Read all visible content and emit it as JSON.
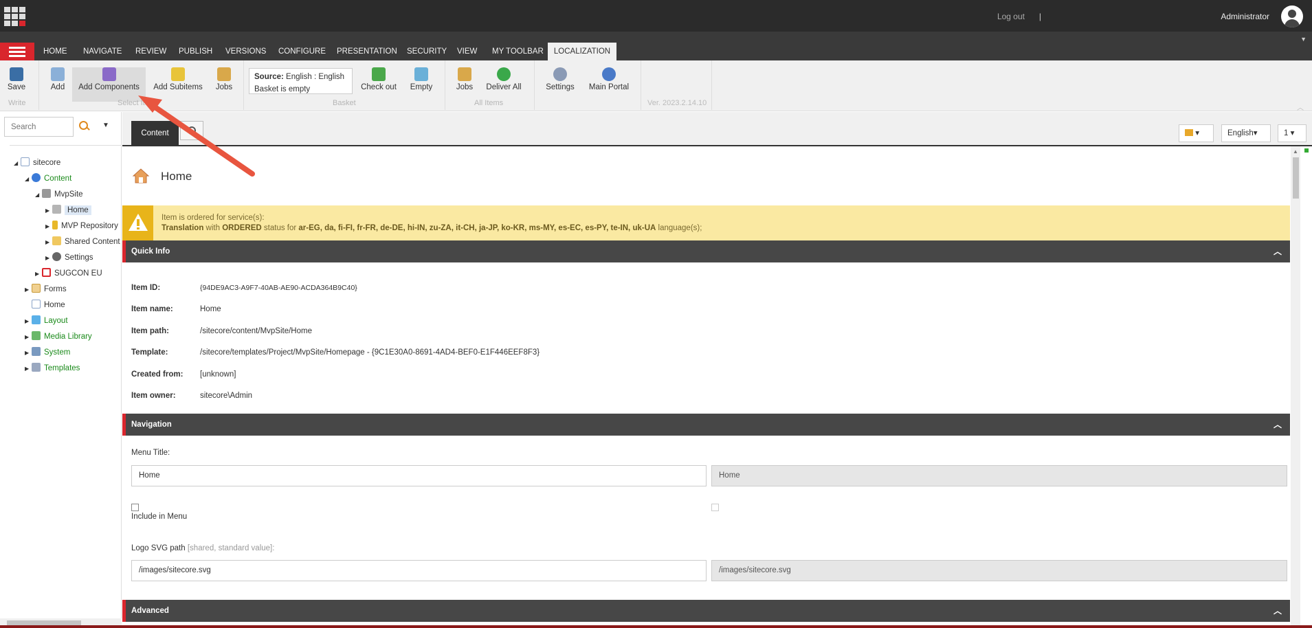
{
  "header": {
    "logout_label": "Log out",
    "separator": "|",
    "user_name": "Administrator"
  },
  "ribbon_tabs": [
    "HOME",
    "NAVIGATE",
    "REVIEW",
    "PUBLISH",
    "VERSIONS",
    "CONFIGURE",
    "PRESENTATION",
    "SECURITY",
    "VIEW",
    "MY TOOLBAR",
    "LOCALIZATION"
  ],
  "active_tab": "LOCALIZATION",
  "ribbon": {
    "save": "Save",
    "write_group": "Write",
    "add": "Add",
    "add_components": "Add Components",
    "add_subitems": "Add Subitems",
    "jobs": "Jobs",
    "select_item_group": "Select Item",
    "basket_source_label": "Source:",
    "basket_source_value": "English : English",
    "basket_status": "Basket is empty",
    "check_out": "Check out",
    "empty": "Empty",
    "basket_group": "Basket",
    "jobs2": "Jobs",
    "deliver_all": "Deliver All",
    "all_items_group": "All Items",
    "settings": "Settings",
    "main_portal": "Main Portal",
    "version": "Ver. 2023.2.14.10"
  },
  "search": {
    "placeholder": "Search"
  },
  "tree": {
    "sitecore": "sitecore",
    "content": "Content",
    "mvpsite": "MvpSite",
    "home": "Home",
    "mvp_repository": "MVP Repository",
    "shared_content": "Shared Content",
    "settings": "Settings",
    "sugcon": "SUGCON EU",
    "forms": "Forms",
    "home_root": "Home",
    "layout": "Layout",
    "media_library": "Media Library",
    "system": "System",
    "templates": "Templates"
  },
  "content_tabs": {
    "content": "Content",
    "language": "English",
    "version": "1"
  },
  "item": {
    "title": "Home",
    "warning_line1": "Item is ordered for service(s):",
    "warning_bold1": "Translation",
    "warning_mid1": " with ",
    "warning_bold2": "ORDERED",
    "warning_mid2": " status for ",
    "warning_langs": "ar-EG, da, fi-FI, fr-FR, de-DE, hi-IN, zu-ZA, it-CH, ja-JP, ko-KR, ms-MY, es-EC, es-PY, te-IN, uk-UA",
    "warning_end": " language(s);"
  },
  "quick_info": {
    "title": "Quick Info",
    "id_label": "Item ID:",
    "id_value": "{94DE9AC3-A9F7-40AB-AE90-ACDA364B9C40}",
    "name_label": "Item name:",
    "name_value": "Home",
    "path_label": "Item path:",
    "path_value": "/sitecore/content/MvpSite/Home",
    "template_label": "Template:",
    "template_value": "/sitecore/templates/Project/MvpSite/Homepage - {9C1E30A0-8691-4AD4-BEF0-E1F446EEF8F3}",
    "created_label": "Created from:",
    "created_value": "[unknown]",
    "owner_label": "Item owner:",
    "owner_value": "sitecore\\Admin"
  },
  "navigation": {
    "title": "Navigation",
    "menu_title_label": "Menu Title:",
    "menu_title_value": "Home",
    "menu_title_standard": "Home",
    "include_in_menu": "Include in Menu",
    "logo_label": "Logo SVG path",
    "logo_hint": " [shared, standard value]:",
    "logo_value": "/images/sitecore.svg",
    "logo_standard": "/images/sitecore.svg"
  },
  "advanced": {
    "title": "Advanced"
  },
  "colors": {
    "accent_red": "#d9262d",
    "warning_bg": "#fae9a2",
    "tree_green": "#1a8a1a",
    "annotation_arrow": "#e8553f"
  }
}
